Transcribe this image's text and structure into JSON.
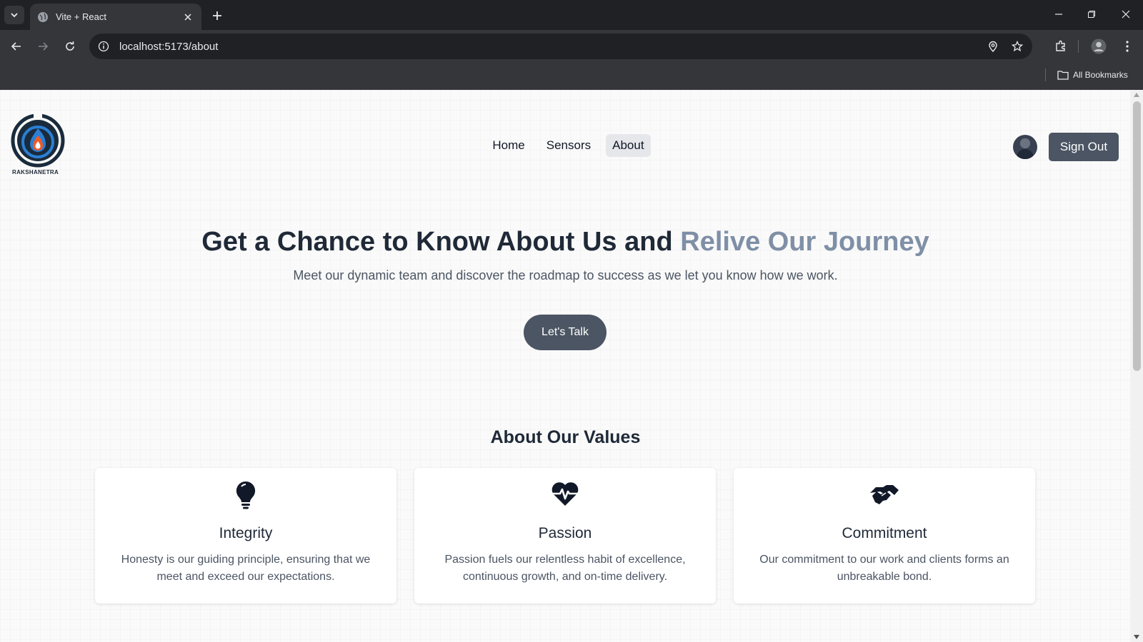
{
  "browser": {
    "tab_title": "Vite + React",
    "url": "localhost:5173/about",
    "bookmarks_label": "All Bookmarks"
  },
  "site": {
    "brand": "RAKSHANETRA",
    "nav": [
      {
        "label": "Home",
        "active": false
      },
      {
        "label": "Sensors",
        "active": false
      },
      {
        "label": "About",
        "active": true
      }
    ],
    "signout_label": "Sign Out"
  },
  "hero": {
    "title_main": "Get a Chance to Know About Us and ",
    "title_accent": "Relive Our Journey",
    "subtitle": "Meet our dynamic team and discover the roadmap to success as we let you know how we work.",
    "cta_label": "Let's Talk"
  },
  "values": {
    "heading": "About Our Values",
    "cards": [
      {
        "icon": "lightbulb-icon",
        "title": "Integrity",
        "description": "Honesty is our guiding principle, ensuring that we meet and exceed our expectations."
      },
      {
        "icon": "heartbeat-icon",
        "title": "Passion",
        "description": "Passion fuels our relentless habit of excellence, continuous growth, and on-time delivery."
      },
      {
        "icon": "handshake-icon",
        "title": "Commitment",
        "description": "Our commitment to our work and clients forms an unbreakable bond."
      }
    ]
  },
  "colors": {
    "primary_button": "#4b5563",
    "accent_text": "#7f8fa6",
    "heading_text": "#1f2937"
  }
}
